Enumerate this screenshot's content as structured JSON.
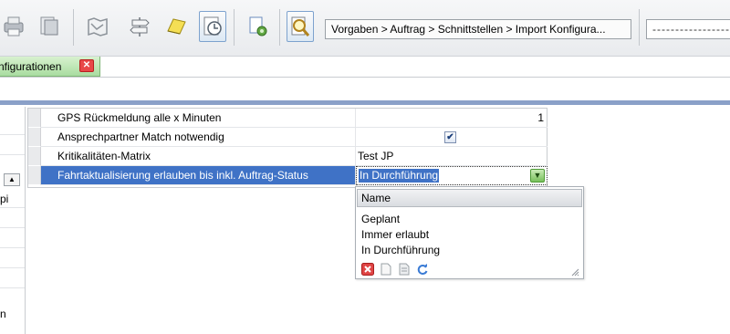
{
  "toolbar": {
    "breadcrumb": "Vorgaben > Auftrag > Schnittstellen > Import Konfigura...",
    "field_value": "--------------------"
  },
  "tab": {
    "label": "nfigurationen",
    "close_symbol": "✕"
  },
  "left_panel": {
    "text_1": "pi",
    "text_2": "n",
    "scroll_symbol": "▲"
  },
  "grid": {
    "rows": [
      {
        "name": "GPS Rückmeldung alle x Minuten",
        "value": "1"
      },
      {
        "name": "Ansprechpartner Match notwendig",
        "value": "✔",
        "checked": true
      },
      {
        "name": "Kritikalitäten-Matrix",
        "value": "Test JP"
      },
      {
        "name": "Fahrtaktualisierung erlauben bis inkl. Auftrag-Status",
        "value": "In Durchführung",
        "selected": true
      }
    ],
    "dropdown_symbol": "▼"
  },
  "popup": {
    "header": "Name",
    "options": [
      "Geplant",
      "Immer erlaubt",
      "In Durchführung"
    ]
  },
  "colors": {
    "selection": "#3f72c6",
    "tab_green": "#a9dca0",
    "accent_bar": "#8aa0c8"
  }
}
